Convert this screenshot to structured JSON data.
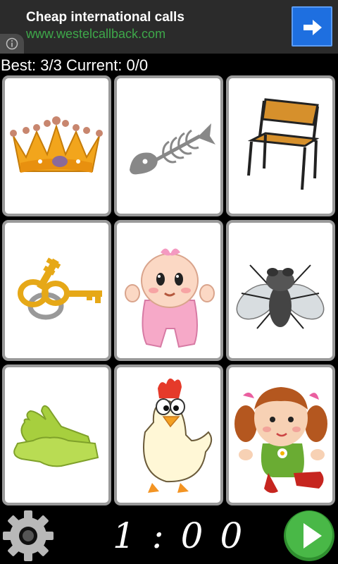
{
  "ad": {
    "title": "Cheap international calls",
    "url": "www.westelcallback.com",
    "info_icon": "info-icon",
    "action_icon": "arrow-right-icon",
    "colors": {
      "background": "#2b2b2b",
      "url": "#3ea84a",
      "button": "#1e6fe0"
    }
  },
  "score": {
    "text": "Best: 3/3 Current: 0/0"
  },
  "cards": [
    {
      "name": "crown",
      "icon": "crown-icon"
    },
    {
      "name": "fish-bone",
      "icon": "fish-bone-icon"
    },
    {
      "name": "chair",
      "icon": "chair-icon"
    },
    {
      "name": "keys",
      "icon": "keys-icon"
    },
    {
      "name": "baby",
      "icon": "baby-icon"
    },
    {
      "name": "fly",
      "icon": "fly-icon"
    },
    {
      "name": "gloves",
      "icon": "gloves-icon"
    },
    {
      "name": "chicken",
      "icon": "chicken-icon"
    },
    {
      "name": "doll",
      "icon": "doll-icon"
    }
  ],
  "controls": {
    "settings_icon": "gear-icon",
    "timer": "1:00",
    "play_icon": "play-icon",
    "colors": {
      "play": "#3aa83a",
      "gear": "#b0b0b0"
    }
  }
}
